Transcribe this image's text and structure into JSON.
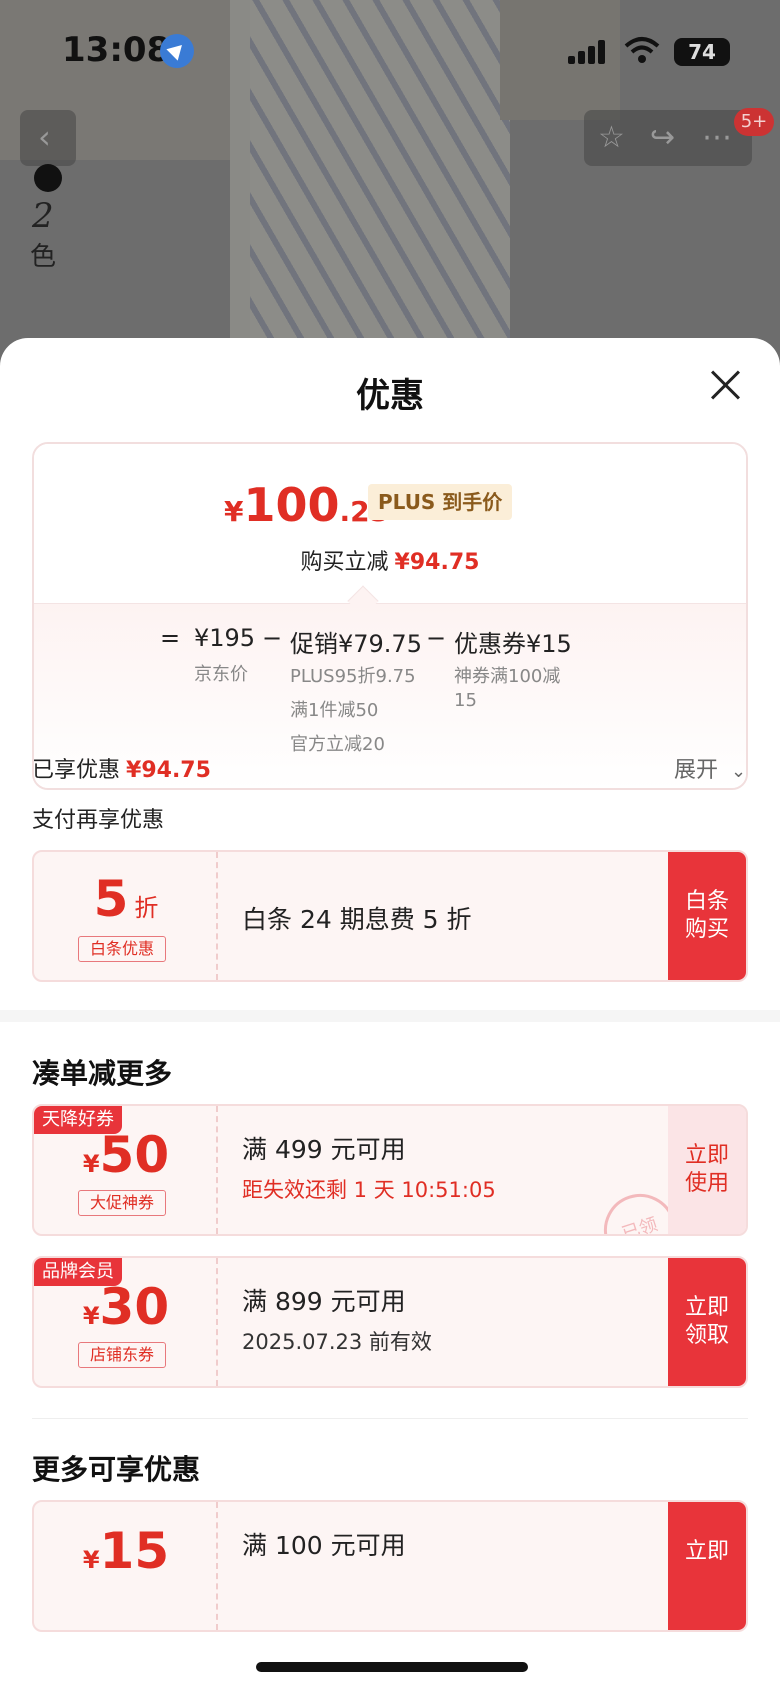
{
  "status_bar": {
    "time": "13:08",
    "battery": "74"
  },
  "product": {
    "color_count": "2",
    "color_label": "色",
    "badge": "5+"
  },
  "sheet": {
    "title": "优惠",
    "price": {
      "yen": "¥",
      "int": "100",
      "dec": ".25",
      "plus_tag": "PLUS 到手价",
      "reduce_label": "购买立减",
      "reduce_value": "¥94.75"
    },
    "breakdown": {
      "eq": "=",
      "jd_price": "¥195",
      "jd_label": "京东价",
      "minus1": "−",
      "promo": "促销¥79.75",
      "promo_details": [
        "PLUS95折9.75",
        "满1件减50",
        "官方立减20"
      ],
      "minus2": "−",
      "coupon": "优惠券¥15",
      "coupon_detail_1": "神券满100减",
      "coupon_detail_2": "15"
    },
    "enjoyed_label": "已享优惠",
    "enjoyed_value": "¥94.75",
    "expand_label": "展开",
    "pay_more_label": "支付再享优惠",
    "baitiao": {
      "amount": "5",
      "unit": "折",
      "type": "白条优惠",
      "text": "白条 24 期息费 5 折",
      "button": [
        "白条",
        "购买"
      ]
    },
    "combine_title": "凑单减更多",
    "coupons": [
      {
        "tag": "天降好券",
        "yen": "¥",
        "amount": "50",
        "type": "大促神券",
        "line1": "满 499 元可用",
        "line2": "距失效还剩 1 天 10:51:05",
        "button": [
          "立即",
          "使用"
        ],
        "stamp": "已领"
      },
      {
        "tag": "品牌会员",
        "yen": "¥",
        "amount": "30",
        "type": "店铺东券",
        "line1": "满 899 元可用",
        "line2": "2025.07.23 前有效",
        "button": [
          "立即",
          "领取"
        ]
      }
    ],
    "more_title": "更多可享优惠",
    "more_coupon": {
      "yen": "¥",
      "amount": "15",
      "line1": "满 100 元可用",
      "button": "立即"
    }
  }
}
